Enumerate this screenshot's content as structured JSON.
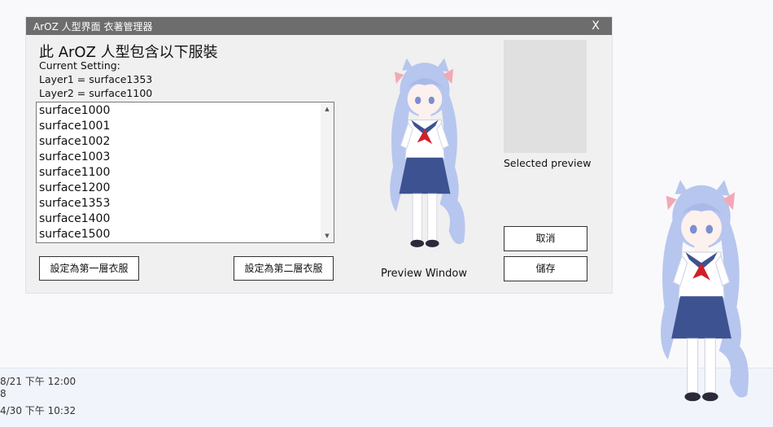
{
  "window": {
    "title": "ArOZ 人型界面 衣著管理器",
    "close_glyph": "X",
    "heading": "此 ArOZ 人型包含以下服裝",
    "current_setting_label": "Current Setting:",
    "layer1_text": "Layer1 = surface1353",
    "layer2_text": "Layer2 = surface1100"
  },
  "surface_list": {
    "items": [
      "surface1000",
      "surface1001",
      "surface1002",
      "surface1003",
      "surface1100",
      "surface1200",
      "surface1353",
      "surface1400",
      "surface1500"
    ]
  },
  "buttons": {
    "set_layer1": "設定為第一層衣服",
    "set_layer2": "設定為第二層衣服",
    "cancel": "取消",
    "save": "儲存"
  },
  "preview": {
    "window_label": "Preview Window",
    "selected_label": "Selected preview"
  },
  "background": {
    "lines": [
      "8/21 下午 12:00",
      "8",
      "4/30 下午 10:32"
    ]
  },
  "colors": {
    "titlebar": "#6d6d6d",
    "window_bg": "#f0f0f0",
    "hair": "#b7c6ee",
    "skirt": "#3d5290",
    "ribbon": "#f2a9b5",
    "scarf": "#d11f2a"
  }
}
